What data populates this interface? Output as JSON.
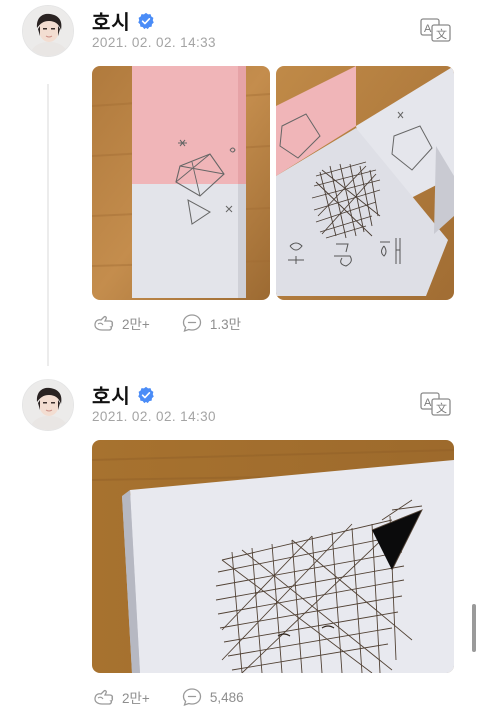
{
  "posts": [
    {
      "author": "호시",
      "timestamp": "2021. 02. 02. 14:33",
      "likes": "2만+",
      "comments": "1.3만",
      "photo_b_handwriting": "호랑해"
    },
    {
      "author": "호시",
      "timestamp": "2021. 02. 02. 14:30",
      "likes": "2만+",
      "comments": "5,486"
    }
  ],
  "icons": {
    "verified": "verified-badge-icon",
    "translate": "translate-icon",
    "like": "like-icon",
    "comment": "comment-icon"
  },
  "colors": {
    "verified": "#4a8cf7",
    "meta_text": "#a4a4a4",
    "action_text": "#8e8e8e"
  }
}
